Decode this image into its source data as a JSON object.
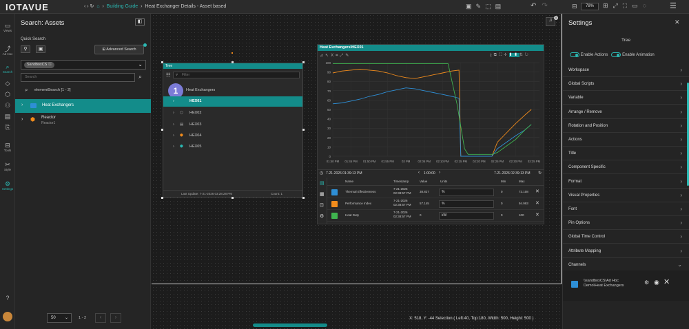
{
  "app": {
    "logo": "IOTAVUE"
  },
  "breadcrumb": {
    "nav": "‹  ›  ↻",
    "home": "⌂",
    "sep": "›",
    "guide": "Building Guide",
    "page": "Heat Exchanger Details - Asset based"
  },
  "toolbar": {
    "zoom": "78%"
  },
  "rail": [
    {
      "label": "Views",
      "icon": "▭"
    },
    {
      "label": "Ad Hoc",
      "icon": "⤴"
    },
    {
      "label": "Search",
      "icon": "⌕"
    },
    {
      "label": "",
      "icon": "◇"
    },
    {
      "label": "",
      "icon": "⬡"
    },
    {
      "label": "",
      "icon": "⚇"
    },
    {
      "label": "",
      "icon": "▤"
    },
    {
      "label": "",
      "icon": "⎘"
    },
    {
      "label": "Tools",
      "icon": "⊟"
    },
    {
      "label": "Style",
      "icon": "✂"
    },
    {
      "label": "Settings",
      "icon": "⚙"
    }
  ],
  "search": {
    "title": "Search: Assets",
    "quick_search": "Quick Search",
    "advanced": "Advanced Search",
    "database": "SandboxCS",
    "placeholder": "Search",
    "result_label": "elementSearch [1 - 2]",
    "results": [
      {
        "name": "Heat Exchangers",
        "sub": ""
      },
      {
        "name": "Reactor",
        "sub": "Reactor1"
      }
    ],
    "page_size": "50",
    "range": "1 - 2"
  },
  "tree": {
    "title": "Tree",
    "filter_placeholder": "Filter",
    "root": "Heat Exchangers",
    "items": [
      "HEX01",
      "HEX02",
      "HEX03",
      "HEX04",
      "HEX05"
    ],
    "last_update": "Last Update: 7-21-2026 03:28:28 PM",
    "count": "Count: 1",
    "badge": "1"
  },
  "trend": {
    "title": "Heat Exchangers\\HEX01",
    "start": "7-21-2026 01:39:13 PM",
    "end": "7-21-2026 02:39:13 PM",
    "duration": "1:00:00",
    "headers": {
      "name": "Name",
      "timestamp": "Timestamp",
      "value": "Value",
      "units": "Units",
      "min": "Min",
      "max": "Max"
    },
    "rows": [
      {
        "name": "Thermal Effectiveness",
        "ts": "7-21-2026 02:38:57 PM",
        "value": "38.827",
        "unit": "%",
        "min": "0",
        "max": "73.108",
        "color": "#2e8fd6"
      },
      {
        "name": "Performance Index",
        "ts": "7-21-2026 02:38:57 PM",
        "value": "57.145",
        "unit": "%",
        "min": "0",
        "max": "94.993",
        "color": "#f28c1c"
      },
      {
        "name": "Heat Duty",
        "ts": "7-21-2026 02:38:57 PM",
        "value": "0",
        "unit": "kW",
        "min": "0",
        "max": "100",
        "color": "#3fb34f"
      }
    ]
  },
  "chart_data": {
    "type": "line",
    "x": [
      "01:40 PM",
      "01:45 PM",
      "01:50 PM",
      "01:55 PM",
      "02 PM",
      "02:05 PM",
      "02:10 PM",
      "02:15 PM",
      "02:20 PM",
      "02:25 PM",
      "02:30 PM",
      "02:35 PM"
    ],
    "yticks": [
      "100",
      "90",
      "80",
      "70",
      "60",
      "50",
      "40",
      "30",
      "20",
      "10",
      "0"
    ],
    "ylim": [
      0,
      100
    ],
    "series": [
      {
        "color": "#f28c1c",
        "points": [
          [
            0,
            89
          ],
          [
            0.5,
            91
          ],
          [
            1,
            92
          ],
          [
            1.5,
            93
          ],
          [
            2,
            92
          ],
          [
            2.5,
            91
          ],
          [
            3,
            89
          ],
          [
            3.5,
            86
          ],
          [
            4,
            84
          ],
          [
            4.5,
            83
          ],
          [
            5,
            85
          ],
          [
            5.5,
            87
          ],
          [
            6,
            89
          ],
          [
            6.5,
            91
          ],
          [
            6.9,
            92
          ],
          [
            7,
            0
          ],
          [
            8.7,
            0
          ],
          [
            9,
            15
          ],
          [
            10,
            35
          ],
          [
            10.5,
            44
          ],
          [
            10.85,
            50
          ]
        ]
      },
      {
        "color": "#2e8fd6",
        "points": [
          [
            0,
            56
          ],
          [
            0.5,
            57
          ],
          [
            1,
            59
          ],
          [
            1.5,
            61
          ],
          [
            2,
            64
          ],
          [
            2.5,
            66
          ],
          [
            3,
            69
          ],
          [
            3.5,
            71
          ],
          [
            4,
            73
          ],
          [
            4.5,
            72
          ],
          [
            5,
            70
          ],
          [
            5.5,
            68
          ],
          [
            6,
            66
          ],
          [
            6.5,
            64
          ],
          [
            6.9,
            62
          ],
          [
            7,
            0
          ],
          [
            8.7,
            0
          ],
          [
            9,
            8
          ],
          [
            10,
            22
          ],
          [
            10.5,
            28
          ],
          [
            10.85,
            34
          ]
        ]
      },
      {
        "color": "#3fb34f",
        "points": [
          [
            0,
            99
          ],
          [
            3,
            99
          ],
          [
            5,
            99
          ],
          [
            6,
            99
          ],
          [
            6.3,
            99
          ],
          [
            6.8,
            55
          ],
          [
            7.2,
            8
          ],
          [
            7.4,
            2
          ],
          [
            8.7,
            2
          ],
          [
            9,
            4
          ],
          [
            10,
            18
          ],
          [
            10.5,
            28
          ],
          [
            10.85,
            34
          ]
        ]
      }
    ]
  },
  "settings": {
    "title": "Settings",
    "subtitle": "Tree",
    "enable_actions": "Enable Actions",
    "enable_animation": "Enable Animation",
    "sections": [
      "Workspace",
      "Global Scripts",
      "Variable",
      "Arrange / Remove",
      "Rotation and Position",
      "Actions",
      "Title",
      "Component Specific",
      "Format",
      "Visual Properties",
      "Font",
      "Pin Options",
      "Global Time Control",
      "Attribute Mapping",
      "Channels"
    ],
    "channel": "\\\\sandboxCS\\Ad Hoc Demo\\Heat Exchangers"
  },
  "status": {
    "text": "X: 518, Y: -44  Selection:( Left:40, Top:180, Width: 500, Height: 500 )"
  }
}
